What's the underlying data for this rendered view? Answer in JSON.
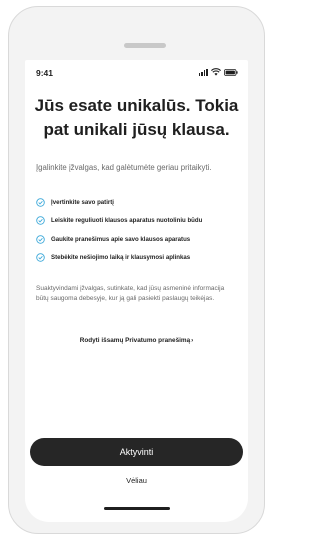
{
  "status_bar": {
    "time": "9:41",
    "icons": [
      "signal-icon",
      "wifi-icon",
      "battery-icon"
    ]
  },
  "headline": "Jūs esate unikalūs. Tokia pat unikali jūsų klausa.",
  "intro": "Įgalinkite įžvalgas, kad galėtumėte geriau pritaikyti.",
  "benefits": [
    {
      "icon": "check-circle-icon",
      "label": "Įvertinkite savo patirtį"
    },
    {
      "icon": "check-circle-icon",
      "label": "Leiskite reguliuoti klausos aparatus nuotoliniu būdu"
    },
    {
      "icon": "check-circle-icon",
      "label": "Gaukite pranešimus apie savo klausos aparatus"
    },
    {
      "icon": "check-circle-icon",
      "label": "Stebėkite nešiojimo laiką ir klausymosi aplinkas"
    }
  ],
  "consent_text": "Suaktyvindami įžvalgas, sutinkate, kad jūsų asmeninė informacija būtų saugoma debesyje, kur ją gali pasiekti paslaugų teikėjas.",
  "privacy_link": {
    "label": "Rodyti išsamų Privatumo pranešimą",
    "arrow": "›"
  },
  "actions": {
    "activate_label": "Aktyvinti",
    "later_label": "Vėliau"
  },
  "colors": {
    "accent": "#3ba8d9",
    "button_bg": "#262626",
    "text": "#1f1f1f",
    "muted": "#6a6a6a"
  }
}
